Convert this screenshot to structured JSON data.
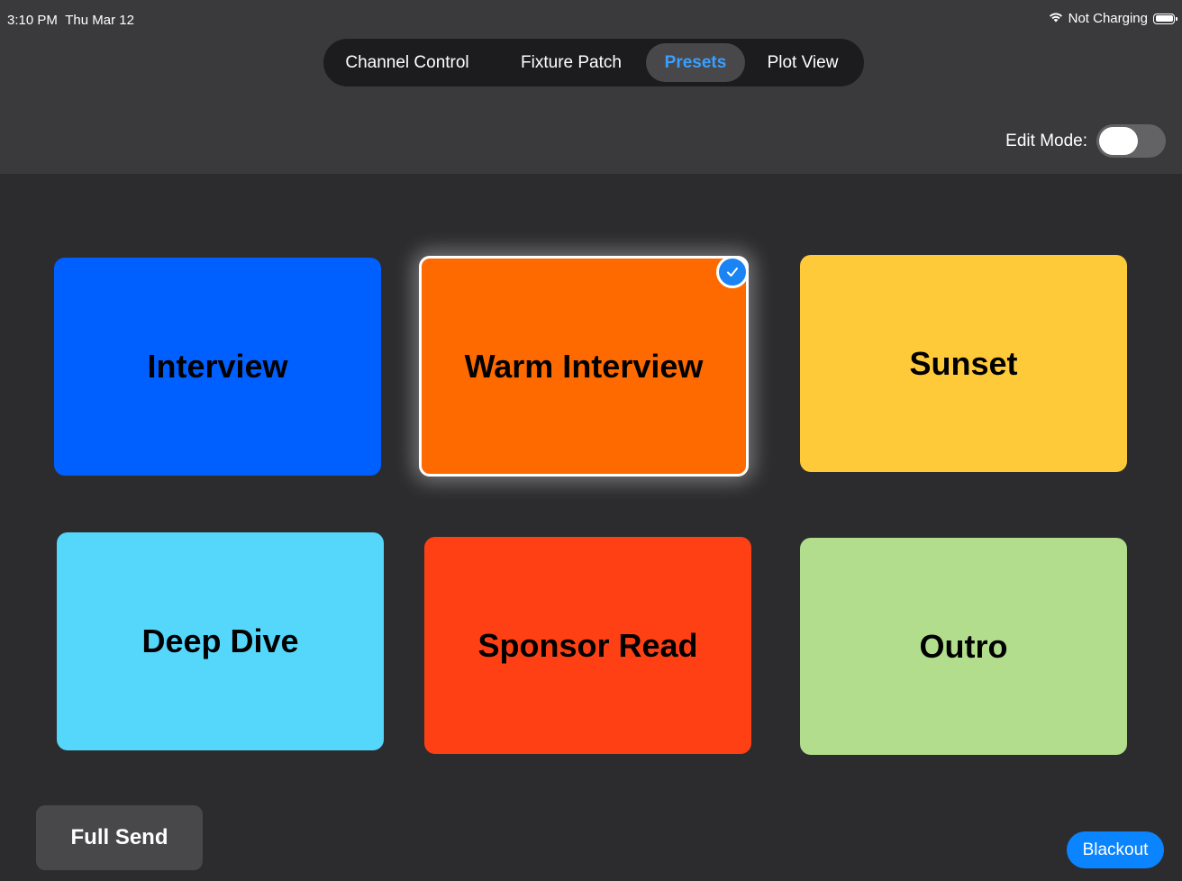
{
  "status_bar": {
    "time": "3:10 PM",
    "date": "Thu Mar 12",
    "wifi_icon": "wifi-icon",
    "battery_text": "Not Charging",
    "battery_icon": "battery-icon"
  },
  "tabs": [
    {
      "label": "Channel Control",
      "active": false
    },
    {
      "label": "Fixture Patch",
      "active": false
    },
    {
      "label": "Presets",
      "active": true
    },
    {
      "label": "Plot View",
      "active": false
    }
  ],
  "edit_mode": {
    "label": "Edit Mode:",
    "on": false
  },
  "presets": [
    {
      "label": "Interview",
      "color": "#0060ff",
      "selected": false
    },
    {
      "label": "Warm Interview",
      "color": "#ff6a00",
      "selected": true
    },
    {
      "label": "Sunset",
      "color": "#ffca3a",
      "selected": false
    },
    {
      "label": "Deep Dive",
      "color": "#55d6fb",
      "selected": false
    },
    {
      "label": "Sponsor Read",
      "color": "#ff4014",
      "selected": false
    },
    {
      "label": "Outro",
      "color": "#b1dd8c",
      "selected": false
    }
  ],
  "actions": {
    "full_send": "Full Send",
    "blackout": "Blackout"
  },
  "colors": {
    "accent": "#0a84ff",
    "active_tab_text": "#3a9fff",
    "background": "#2c2c2e",
    "header": "#3a3a3c"
  }
}
